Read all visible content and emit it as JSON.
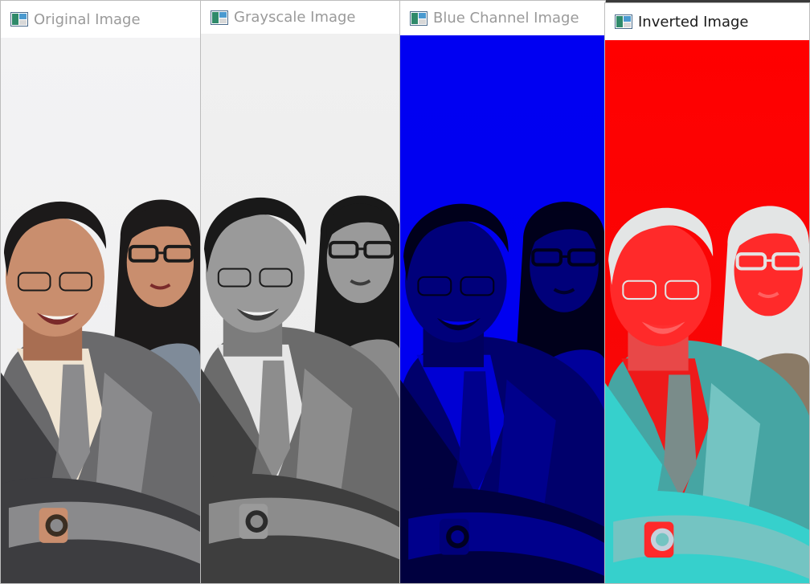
{
  "windows": [
    {
      "id": "original",
      "title": "Original Image",
      "color_mode": "original"
    },
    {
      "id": "grayscale",
      "title": "Grayscale Image",
      "color_mode": "grayscale"
    },
    {
      "id": "blue",
      "title": "Blue Channel Image",
      "color_mode": "blue-channel"
    },
    {
      "id": "inverted",
      "title": "Inverted Image",
      "color_mode": "inverted",
      "active": true
    }
  ],
  "window_icon": "image-window-icon",
  "photo": {
    "subject": "two smiling business people in suits, man with arms crossed and wristwatch, woman with glasses behind him",
    "palettes": {
      "original": {
        "bg": "#f3f3f4",
        "bg2": "#eeeeef",
        "hair": "#1c1a1a",
        "skin": "#c98e6e",
        "skin_shade": "#a86e52",
        "suit": "#6a6a6c",
        "suit_dark": "#3d3d40",
        "suit_light": "#8a8a8c",
        "shirt": "#efe4d2",
        "tie": "#8b8b8d",
        "jacket2": "#7f8b99",
        "glasses": "#1b1b1b",
        "mouth": "#7a2a2a",
        "teeth": "#f7f4ee",
        "watch": "#3a2e22"
      },
      "grayscale": {
        "bg": "#f0f0f0",
        "bg2": "#ebebeb",
        "hair": "#191919",
        "skin": "#9a9a9a",
        "skin_shade": "#7c7c7c",
        "suit": "#6b6b6b",
        "suit_dark": "#3e3e3e",
        "suit_light": "#8c8c8c",
        "shirt": "#e6e6e6",
        "tie": "#8d8d8d",
        "jacket2": "#8a8a8a",
        "glasses": "#1a1a1a",
        "mouth": "#3c3c3c",
        "teeth": "#f3f3f3",
        "watch": "#2b2b2b"
      },
      "blue-channel": {
        "bg": "#0000f2",
        "bg2": "#0000ee",
        "hair": "#00001b",
        "skin": "#00007a",
        "skin_shade": "#000060",
        "suit": "#00006c",
        "suit_dark": "#00003f",
        "suit_light": "#00008c",
        "shirt": "#0000d4",
        "tie": "#00008d",
        "jacket2": "#00009a",
        "glasses": "#00001b",
        "mouth": "#00002c",
        "teeth": "#0000ee",
        "watch": "#000022"
      },
      "inverted": {
        "bg": "#ff0000",
        "bg2": "#f40a0a",
        "hair": "#e3e5e5",
        "skin": "#ff2a2a",
        "skin_shade": "#e84848",
        "suit": "#46a5a3",
        "suit_dark": "#36d0cc",
        "suit_light": "#74c4c2",
        "shirt": "#ee1a1a",
        "tie": "#7a8c8a",
        "jacket2": "#8a7a66",
        "glasses": "#e4e4e4",
        "mouth": "#ff6060",
        "teeth": "#ff3030",
        "watch": "#c5d1dd"
      }
    }
  }
}
